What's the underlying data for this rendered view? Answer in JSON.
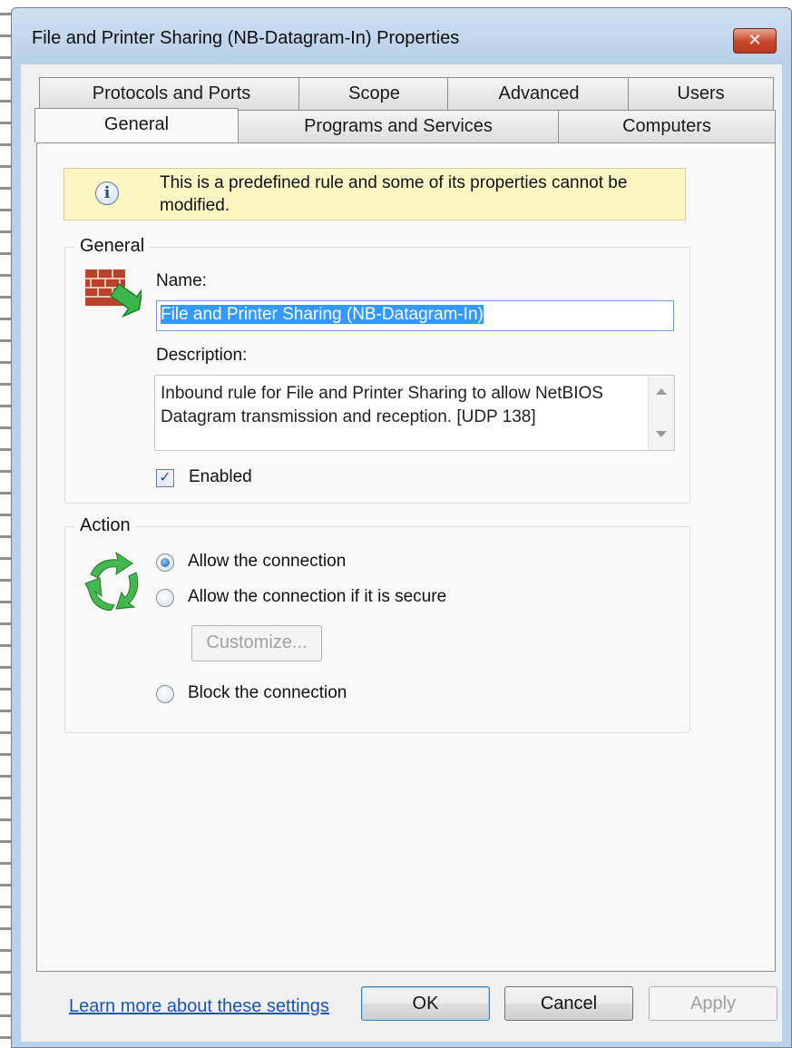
{
  "window": {
    "title": "File and Printer Sharing (NB-Datagram-In) Properties",
    "close_glyph": "✕"
  },
  "tabs": {
    "row1": [
      "Protocols and Ports",
      "Scope",
      "Advanced",
      "Users"
    ],
    "row2": [
      "General",
      "Programs and Services",
      "Computers"
    ],
    "selected": "General"
  },
  "info": {
    "icon": "info-icon",
    "glyph": "i",
    "text": "This is a predefined rule and some of its properties cannot be modified."
  },
  "general": {
    "group_label": "General",
    "name_label": "Name:",
    "name_value": "File and Printer Sharing (NB-Datagram-In)",
    "description_label": "Description:",
    "description_value": "Inbound rule for File and Printer Sharing to allow NetBIOS Datagram transmission and reception. [UDP 138]",
    "enabled_label": "Enabled",
    "enabled_checked": true,
    "check_glyph": "✓"
  },
  "action": {
    "group_label": "Action",
    "options": [
      "Allow the connection",
      "Allow the connection if it is secure",
      "Block the connection"
    ],
    "selected_index": 0,
    "customize_label": "Customize..."
  },
  "link": {
    "learn_more": "Learn more about these settings"
  },
  "buttons": {
    "ok": "OK",
    "cancel": "Cancel",
    "apply": "Apply"
  },
  "colors": {
    "title_bar": "#b9d1ea",
    "info_bg": "#fbf6c2",
    "link": "#1a55b3",
    "close": "#c7462b"
  }
}
